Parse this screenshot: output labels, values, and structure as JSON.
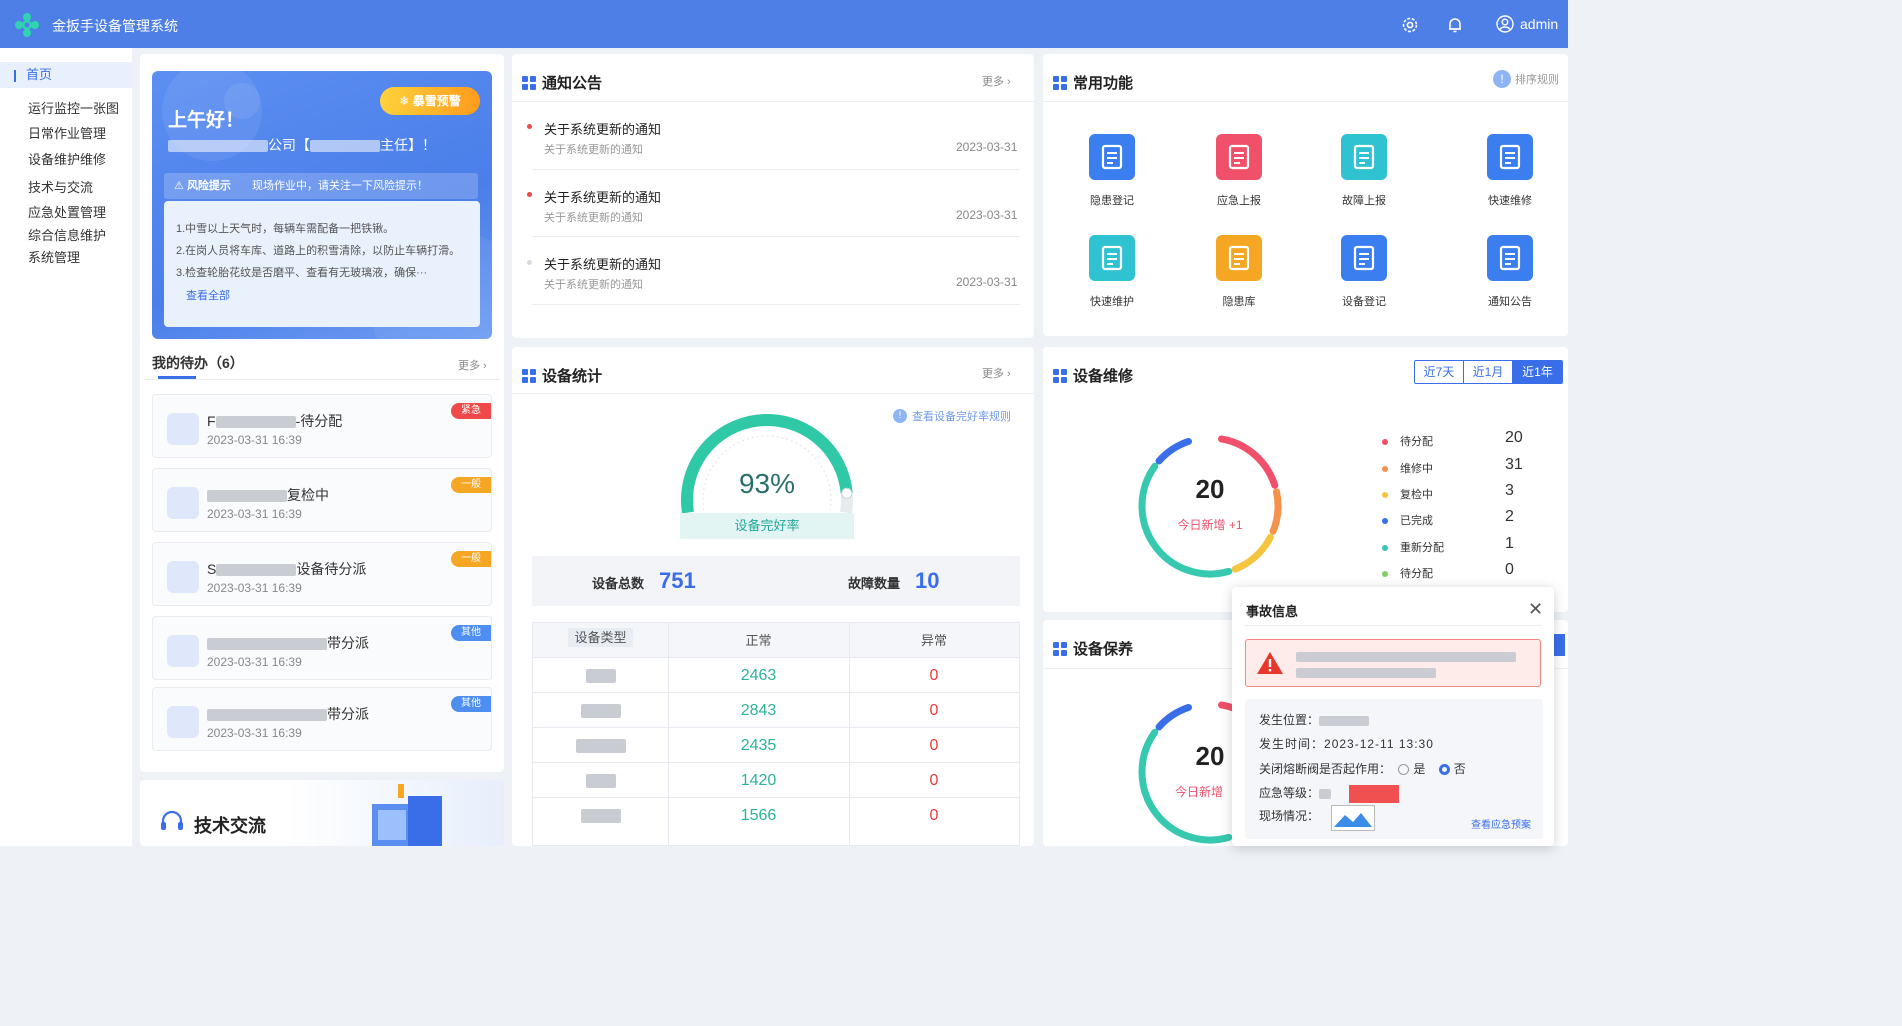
{
  "header": {
    "title": "金扳手设备管理系统",
    "user": "admin"
  },
  "sidebar": {
    "active": "首页",
    "items": [
      "运行监控一张图",
      "日常作业管理",
      "设备维护维修",
      "技术与交流",
      "应急处置管理",
      "综合信息维护",
      "系统管理"
    ]
  },
  "welcome": {
    "greeting": "上午好！",
    "company_suffix": "公司【",
    "role_suffix": "主任】！",
    "badge": "暴雪预警",
    "risk_label": "风险提示",
    "risk_text": "现场作业中，请关注一下风险提示！",
    "tips": [
      "1.中雪以上天气时，每辆车需配备一把铁锹。",
      "2.在岗人员将车库、道路上的积雪清除，以防止车辆打滑。",
      "3.检查轮胎花纹是否磨平、查看有无玻璃液，确保···"
    ],
    "view_all": "查看全部"
  },
  "todo": {
    "title": "我的待办（6）",
    "more": "更多",
    "items": [
      {
        "prefix": "F",
        "title": "-待分配",
        "time": "2023-03-31 16:39",
        "tag": "紧急",
        "color": "#f0494a"
      },
      {
        "prefix": "",
        "title": "复检中",
        "time": "2023-03-31 16:39",
        "tag": "一般",
        "color": "#f5a623"
      },
      {
        "prefix": "S",
        "title": "设备待分派",
        "time": "2023-03-31 16:39",
        "tag": "一般",
        "color": "#f5a623"
      },
      {
        "prefix": "",
        "title": "带分派",
        "time": "2023-03-31 16:39",
        "tag": "其他",
        "color": "#4d8ef0"
      },
      {
        "prefix": "",
        "title": "带分派",
        "time": "2023-03-31 16:39",
        "tag": "其他",
        "color": "#4d8ef0"
      }
    ]
  },
  "tech": {
    "title": "技术交流"
  },
  "notice": {
    "title": "通知公告",
    "more": "更多",
    "items": [
      {
        "title": "关于系统更新的通知",
        "sub": "关于系统更新的通知",
        "date": "2023-03-31",
        "dot": "#f0494a"
      },
      {
        "title": "关于系统更新的通知",
        "sub": "关于系统更新的通知",
        "date": "2023-03-31",
        "dot": "#f0494a"
      },
      {
        "title": "关于系统更新的通知",
        "sub": "关于系统更新的通知",
        "date": "2023-03-31",
        "dot": "#d6d9df"
      }
    ]
  },
  "functions": {
    "title": "常用功能",
    "rule": "排序规则",
    "items": [
      {
        "label": "隐患登记",
        "icon": "wrench-icon",
        "color": "#3a7ef0"
      },
      {
        "label": "应急上报",
        "icon": "warning-icon",
        "color": "#f0506a"
      },
      {
        "label": "故障上报",
        "icon": "house-wrench-icon",
        "color": "#2fc3d1"
      },
      {
        "label": "快速维修",
        "icon": "doc-search-icon",
        "color": "#3a7ef0"
      },
      {
        "label": "快速维护",
        "icon": "doc-edit-icon",
        "color": "#2fc3d1"
      },
      {
        "label": "隐患库",
        "icon": "home-warning-icon",
        "color": "#f5a623"
      },
      {
        "label": "设备登记",
        "icon": "device-icon",
        "color": "#3a7ef0"
      },
      {
        "label": "通知公告",
        "icon": "speaker-icon",
        "color": "#3a7ef0"
      }
    ]
  },
  "device_stats": {
    "title": "设备统计",
    "more": "更多",
    "rule_link": "查看设备完好率规则",
    "rate": 93,
    "rate_text": "93%",
    "rate_label": "设备完好率",
    "total_label": "设备总数",
    "total": "751",
    "fault_label": "故障数量",
    "fault": "10",
    "table": {
      "headers": [
        "设备类型",
        "正常",
        "异常"
      ],
      "rows": [
        {
          "normal": "2463",
          "abnormal": "0"
        },
        {
          "normal": "2843",
          "abnormal": "0"
        },
        {
          "normal": "2435",
          "abnormal": "0"
        },
        {
          "normal": "1420",
          "abnormal": "0"
        },
        {
          "normal": "1566",
          "abnormal": "0"
        }
      ]
    }
  },
  "repair": {
    "title": "设备维修",
    "ranges": [
      "近7天",
      "近1月",
      "近1年"
    ],
    "center_value": "20",
    "center_label": "今日新增 +1",
    "legend": [
      {
        "label": "待分配",
        "value": "20",
        "color": "#f0506a"
      },
      {
        "label": "维修中",
        "value": "31",
        "color": "#f5914a"
      },
      {
        "label": "复检中",
        "value": "3",
        "color": "#f5c542"
      },
      {
        "label": "已完成",
        "value": "2",
        "color": "#3a6ee8"
      },
      {
        "label": "重新分配",
        "value": "1",
        "color": "#36c9b0"
      },
      {
        "label": "待分配",
        "value": "0",
        "color": "#7ed063"
      }
    ]
  },
  "maintain": {
    "title": "设备保养",
    "center_value": "20",
    "center_label": "今日新增"
  },
  "popup": {
    "title": "事故信息",
    "location_label": "发生位置：",
    "time_label": "发生时间：",
    "time": "2023-12-11 13:30",
    "valve_label": "关闭熔断阀是否起作用：",
    "yes": "是",
    "no": "否",
    "level_label": "应急等级：",
    "scene_label": "现场情况：",
    "plan_link": "查看应急预案"
  }
}
